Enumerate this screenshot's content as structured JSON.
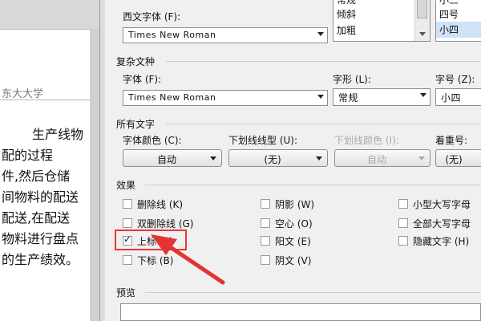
{
  "document": {
    "header_text": "东大大学",
    "lines": [
      "生产线物",
      "配的过程",
      "件,然后仓储",
      "间物料的配送",
      "配送,在配送",
      "物料进行盘点",
      "的生产绩效。"
    ]
  },
  "dialog": {
    "western_font": {
      "label": "西文字体 (F):",
      "value": "Times New Roman"
    },
    "style_list": [
      "常规",
      "倾斜",
      "加粗"
    ],
    "size_list": [
      "小三",
      "四号",
      "小四"
    ],
    "complex_section": {
      "title": "复杂文种"
    },
    "complex_font": {
      "label": "字体 (F):",
      "value": "Times New Roman"
    },
    "complex_style": {
      "label": "字形 (L):",
      "value": "常规"
    },
    "complex_size": {
      "label": "字号 (Z):",
      "value": "小四"
    },
    "all_text_section": {
      "title": "所有文字"
    },
    "font_color": {
      "label": "字体颜色 (C):",
      "value": "自动"
    },
    "underline_style": {
      "label": "下划线线型 (U):",
      "value": "(无)"
    },
    "underline_color": {
      "label": "下划线颜色 (I):",
      "value": "自动"
    },
    "emphasis": {
      "label": "着重号:",
      "value": "(无)"
    },
    "effects_section": {
      "title": "效果"
    },
    "effects": {
      "strikethrough": "删除线 (K)",
      "double_strikethrough": "双删除线 (G)",
      "superscript": "上标 (P)",
      "subscript": "下标 (B)",
      "shadow": "阴影 (W)",
      "outline": "空心 (O)",
      "emboss": "阳文 (E)",
      "engrave": "阴文 (V)",
      "small_caps": "小型大写字母",
      "all_caps": "全部大写字母",
      "hidden": "隐藏文字 (H)"
    },
    "preview_section": {
      "title": "预览"
    }
  },
  "colors": {
    "annotation_red": "#e33333"
  }
}
